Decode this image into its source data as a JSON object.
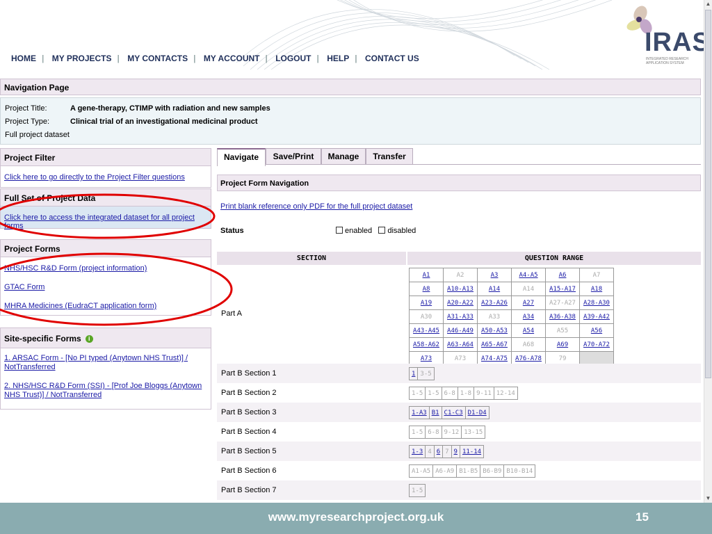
{
  "header": {
    "nav": [
      "HOME",
      "MY PROJECTS",
      "MY CONTACTS",
      "MY ACCOUNT",
      "LOGOUT",
      "HELP",
      "CONTACT US"
    ],
    "logo_text": "IRAS",
    "logo_subtext": "INTEGRATED RESEARCH APPLICATION SYSTEM"
  },
  "navigation_page_title": "Navigation Page",
  "project": {
    "title_label": "Project Title:",
    "title_value": "A gene-therapy, CTIMP with radiation and new samples",
    "type_label": "Project Type:",
    "type_value": "Clinical trial of an investigational medicinal product",
    "dataset": "Full project dataset"
  },
  "left": {
    "filter_header": "Project Filter",
    "filter_link": "Click here to go directly to the Project Filter questions",
    "fullset_header": "Full Set of Project Data",
    "fullset_link": "Click here to access the integrated dataset for all project forms",
    "forms_header": "Project Forms",
    "forms": [
      "NHS/HSC R&D Form (project information)",
      "GTAC Form",
      "MHRA Medicines (EudraCT application form)"
    ],
    "site_header": "Site-specific Forms",
    "site_forms": [
      "1. ARSAC Form - [No PI typed (Anytown NHS Trust)] / NotTransferred",
      "2. NHS/HSC R&D Form (SSI) - [Prof Joe Bloggs (Anytown NHS Trust)] / NotTransferred"
    ]
  },
  "tabs": [
    "Navigate",
    "Save/Print",
    "Manage",
    "Transfer"
  ],
  "form_nav": {
    "header": "Project Form Navigation",
    "print_link": "Print blank reference only PDF for the full project dataset",
    "status_label": "Status",
    "enabled": "enabled",
    "disabled": "disabled",
    "col_section": "SECTION",
    "col_range": "QUESTION RANGE"
  },
  "part_a": {
    "label": "Part A",
    "grid": [
      [
        [
          "A1",
          "l"
        ],
        [
          "A2",
          "d"
        ],
        [
          "A3",
          "l"
        ],
        [
          "A4-A5",
          "l"
        ],
        [
          "A6",
          "l"
        ],
        [
          "A7",
          "d"
        ]
      ],
      [
        [
          "A8",
          "l"
        ],
        [
          "A10-A13",
          "l"
        ],
        [
          "A14",
          "l"
        ],
        [
          "A14",
          "d"
        ],
        [
          "A15-A17",
          "l"
        ],
        [
          "A18",
          "l"
        ]
      ],
      [
        [
          "A19",
          "l"
        ],
        [
          "A20-A22",
          "l"
        ],
        [
          "A23-A26",
          "l"
        ],
        [
          "A27",
          "l"
        ],
        [
          "A27-A27",
          "d"
        ],
        [
          "A28-A30",
          "l"
        ]
      ],
      [
        [
          "A30",
          "d"
        ],
        [
          "A31-A33",
          "l"
        ],
        [
          "A33",
          "d"
        ],
        [
          "A34",
          "l"
        ],
        [
          "A36-A38",
          "l"
        ],
        [
          "A39-A42",
          "l"
        ]
      ],
      [
        [
          "A43-A45",
          "l"
        ],
        [
          "A46-A49",
          "l"
        ],
        [
          "A50-A53",
          "l"
        ],
        [
          "A54",
          "l"
        ],
        [
          "A55",
          "d"
        ],
        [
          "A56",
          "l"
        ]
      ],
      [
        [
          "A58-A62",
          "l"
        ],
        [
          "A63-A64",
          "l"
        ],
        [
          "A65-A67",
          "l"
        ],
        [
          "A68",
          "d"
        ],
        [
          "A69",
          "l"
        ],
        [
          "A70-A72",
          "l"
        ]
      ],
      [
        [
          "A73",
          "l"
        ],
        [
          "A73",
          "d"
        ],
        [
          "A74-A75",
          "l"
        ],
        [
          "A76-A78",
          "l"
        ],
        [
          "79",
          "d"
        ],
        [
          "",
          "e"
        ]
      ]
    ]
  },
  "part_b": [
    {
      "label": "Part B Section 1",
      "ranges": [
        [
          "1",
          "l"
        ],
        [
          "3-5",
          "d"
        ]
      ]
    },
    {
      "label": "Part B Section 2",
      "ranges": [
        [
          "1-5",
          "d"
        ],
        [
          "1-5",
          "d"
        ],
        [
          "6-8",
          "d"
        ],
        [
          "1-8",
          "d"
        ],
        [
          "9-11",
          "d"
        ],
        [
          "12-14",
          "d"
        ]
      ]
    },
    {
      "label": "Part B Section 3",
      "ranges": [
        [
          "1-A3",
          "l"
        ],
        [
          "B1",
          "l"
        ],
        [
          "C1-C3",
          "l"
        ],
        [
          "D1-D4",
          "l"
        ]
      ]
    },
    {
      "label": "Part B Section 4",
      "ranges": [
        [
          "1-5",
          "d"
        ],
        [
          "6-8",
          "d"
        ],
        [
          "9-12",
          "d"
        ],
        [
          "13-15",
          "d"
        ]
      ]
    },
    {
      "label": "Part B Section 5",
      "ranges": [
        [
          "1-3",
          "l"
        ],
        [
          "4",
          "d"
        ],
        [
          "6",
          "l"
        ],
        [
          "7",
          "d"
        ],
        [
          "9",
          "l"
        ],
        [
          "11-14",
          "l"
        ]
      ]
    },
    {
      "label": "Part B Section 6",
      "ranges": [
        [
          "A1-A5",
          "d"
        ],
        [
          "A6-A9",
          "d"
        ],
        [
          "B1-B5",
          "d"
        ],
        [
          "B6-B9",
          "d"
        ],
        [
          "B10-B14",
          "d"
        ]
      ]
    },
    {
      "label": "Part B Section 7",
      "ranges": [
        [
          "1-5",
          "d"
        ]
      ]
    }
  ],
  "footer": {
    "url": "www.myresearchproject.org.uk",
    "page": "15"
  },
  "colors": {
    "header_bar": "#efe8f0",
    "footer": "#8aacb0",
    "annotation": "#e00000",
    "link": "#1a1aa6"
  }
}
